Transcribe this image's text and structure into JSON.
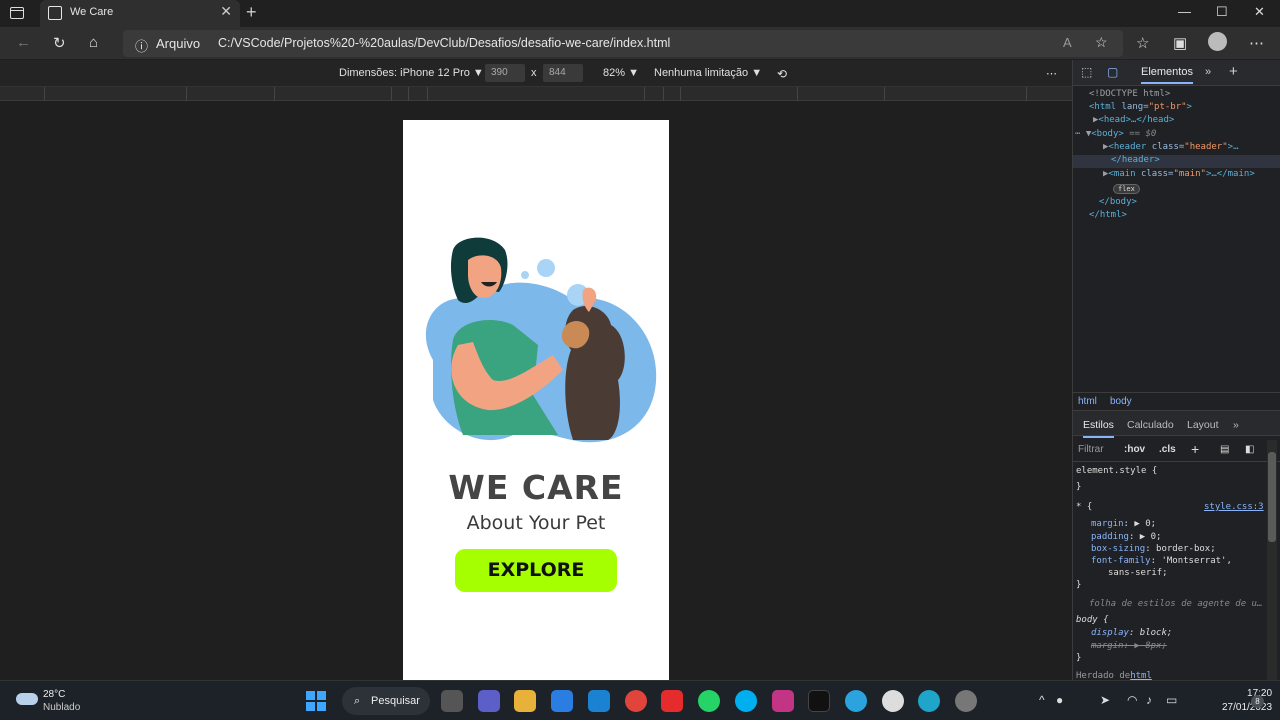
{
  "browser": {
    "tab_title": "We Care",
    "address_scheme": "Arquivo",
    "address_url": "C:/VSCode/Projetos%20-%20aulas/DevClub/Desafios/desafio-we-care/index.html"
  },
  "device_toolbar": {
    "dimensions_label": "Dimensões: iPhone 12 Pro",
    "width": "390",
    "height": "844",
    "times": "x",
    "zoom": "82%",
    "throttle": "Nenhuma limitação"
  },
  "page": {
    "title": "WE CARE",
    "subtitle": "About Your Pet",
    "button_label": "EXPLORE",
    "button_color": "#a6ff00",
    "title_color": "#454545"
  },
  "devtools": {
    "tab_elements": "Elementos",
    "dom": {
      "doctype": "<!DOCTYPE html>",
      "html_open_tag": "<html ",
      "html_lang_attr": "lang=",
      "html_lang_val": "\"pt-br\"",
      "html_close_bracket": ">",
      "head": "<head>…</head>",
      "body_open": "<body>",
      "body_sel": "== $0",
      "header_open": "<header ",
      "header_attr": "class=",
      "header_val": "\"header\"",
      "header_tail": ">…",
      "header_close": "</header>",
      "main_open": "<main ",
      "main_attr": "class=",
      "main_val": "\"main\"",
      "main_tail": ">…</main>",
      "flex_badge": "flex",
      "body_close": "</body>",
      "html_close": "</html>"
    },
    "breadcrumbs": [
      "html",
      "body"
    ],
    "subtabs": [
      "Estilos",
      "Calculado",
      "Layout"
    ],
    "filter_placeholder": "Filtrar",
    "hov": ":hov",
    "cls": ".cls",
    "styles": {
      "element_style": "element.style {",
      "close": "}",
      "universal": "* {",
      "source": "style.css:3",
      "margin_prop": "margin",
      "margin_val": "▶ 0;",
      "padding_prop": "padding",
      "padding_val": "▶ 0;",
      "boxsizing_prop": "box-sizing",
      "boxsizing_val": "border-box;",
      "fontfamily_prop": "font-family",
      "fontfamily_val": "'Montserrat',",
      "fontfamily_val2": "sans-serif;",
      "ua_comment": "folha de estilos de agente de u…",
      "body_rule": "body {",
      "display_prop": "display",
      "display_val": "block;",
      "ua_margin_prop": "margin",
      "ua_margin_val": "▶ 8px;",
      "inherited": "Herdado de",
      "inherited_tag": "html"
    }
  },
  "taskbar": {
    "temperature": "28°C",
    "weather": "Nublado",
    "search_label": "Pesquisar",
    "time": "17:20",
    "date": "27/01/2023",
    "notifications": "8"
  }
}
